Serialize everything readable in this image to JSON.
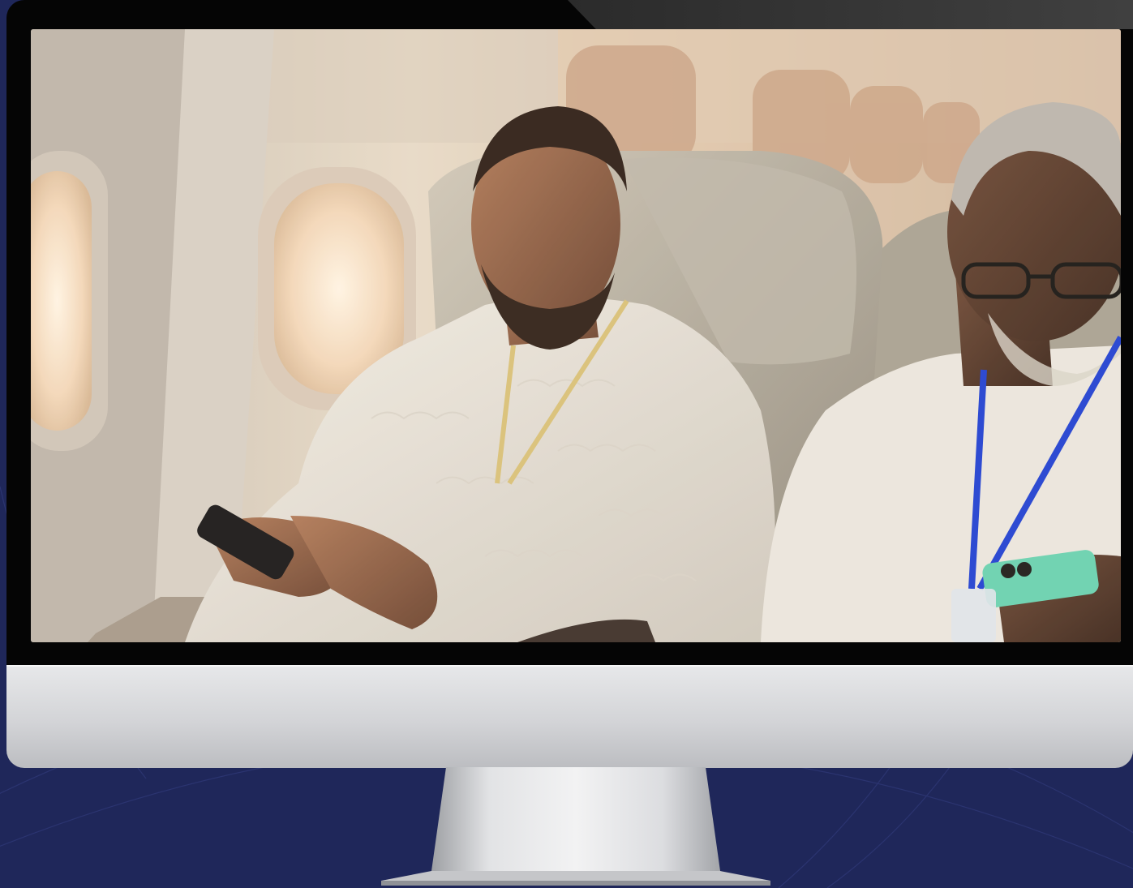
{
  "page": {
    "background_color": "#1f275a"
  },
  "monitor": {
    "type": "desktop-monitor-mockup",
    "bezel_color": "#050505",
    "body_color": "#d3d4d7"
  },
  "screen": {
    "content": "video-frame",
    "scene": {
      "setting": "airplane-cabin",
      "people": [
        {
          "name": "passenger-left",
          "clothing": "white-ihram",
          "lanyard_color": "#d8c27a",
          "device": "smartphone"
        },
        {
          "name": "passenger-right",
          "clothing": "white-ihram",
          "lanyard_color": "#1d3fd6",
          "device": "smartphone",
          "eyewear": "glasses"
        }
      ]
    }
  }
}
